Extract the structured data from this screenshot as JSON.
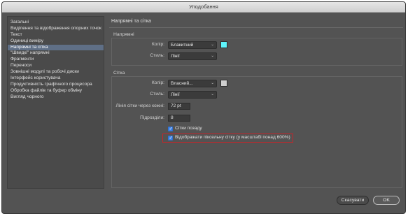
{
  "window": {
    "title": "Уподобання"
  },
  "sidebar": {
    "items": [
      {
        "label": "Загальні",
        "active": false
      },
      {
        "label": "Виділення та відображення опорних точок",
        "active": false
      },
      {
        "label": "Текст",
        "active": false
      },
      {
        "label": "Одиниці виміру",
        "active": false
      },
      {
        "label": "Напрямні та сітка",
        "active": true
      },
      {
        "label": "\"Швидкі\" напрямні",
        "active": false
      },
      {
        "label": "Фрагменти",
        "active": false
      },
      {
        "label": "Переноси",
        "active": false
      },
      {
        "label": "Зовнішні модулі та робочі диски",
        "active": false
      },
      {
        "label": "Інтерфейс користувача",
        "active": false
      },
      {
        "label": "Продуктивність графічного процесора",
        "active": false
      },
      {
        "label": "Обробка файлів та буфер обміну",
        "active": false
      },
      {
        "label": "Вигляд чорного",
        "active": false
      }
    ]
  },
  "main": {
    "title": "Напрямні та сітка",
    "guides": {
      "heading": "Напрямні",
      "color_label": "Колір:",
      "color_value": "Блакитний",
      "color_swatch": "#5ef4fb",
      "style_label": "Стиль:",
      "style_value": "Лінії"
    },
    "grid": {
      "heading": "Сітка",
      "color_label": "Колір:",
      "color_value": "Власний...",
      "color_swatch": "#cfcfcf",
      "style_label": "Стиль:",
      "style_value": "Лінії",
      "every_label": "Лінія сітки через кожні:",
      "every_value": "72 pt",
      "subdiv_label": "Підрозділи:",
      "subdiv_value": "8",
      "behind_label": "Сітки позаду",
      "behind_checked": true,
      "pixel_label": "Відображати піксельну сітку (у масштабі понад 600%)",
      "pixel_checked": true
    }
  },
  "footer": {
    "cancel_label": "Скасувати",
    "ok_label": "OK"
  },
  "colors": {
    "highlight": "#c4262b",
    "checkbox": "#3f83e6"
  }
}
